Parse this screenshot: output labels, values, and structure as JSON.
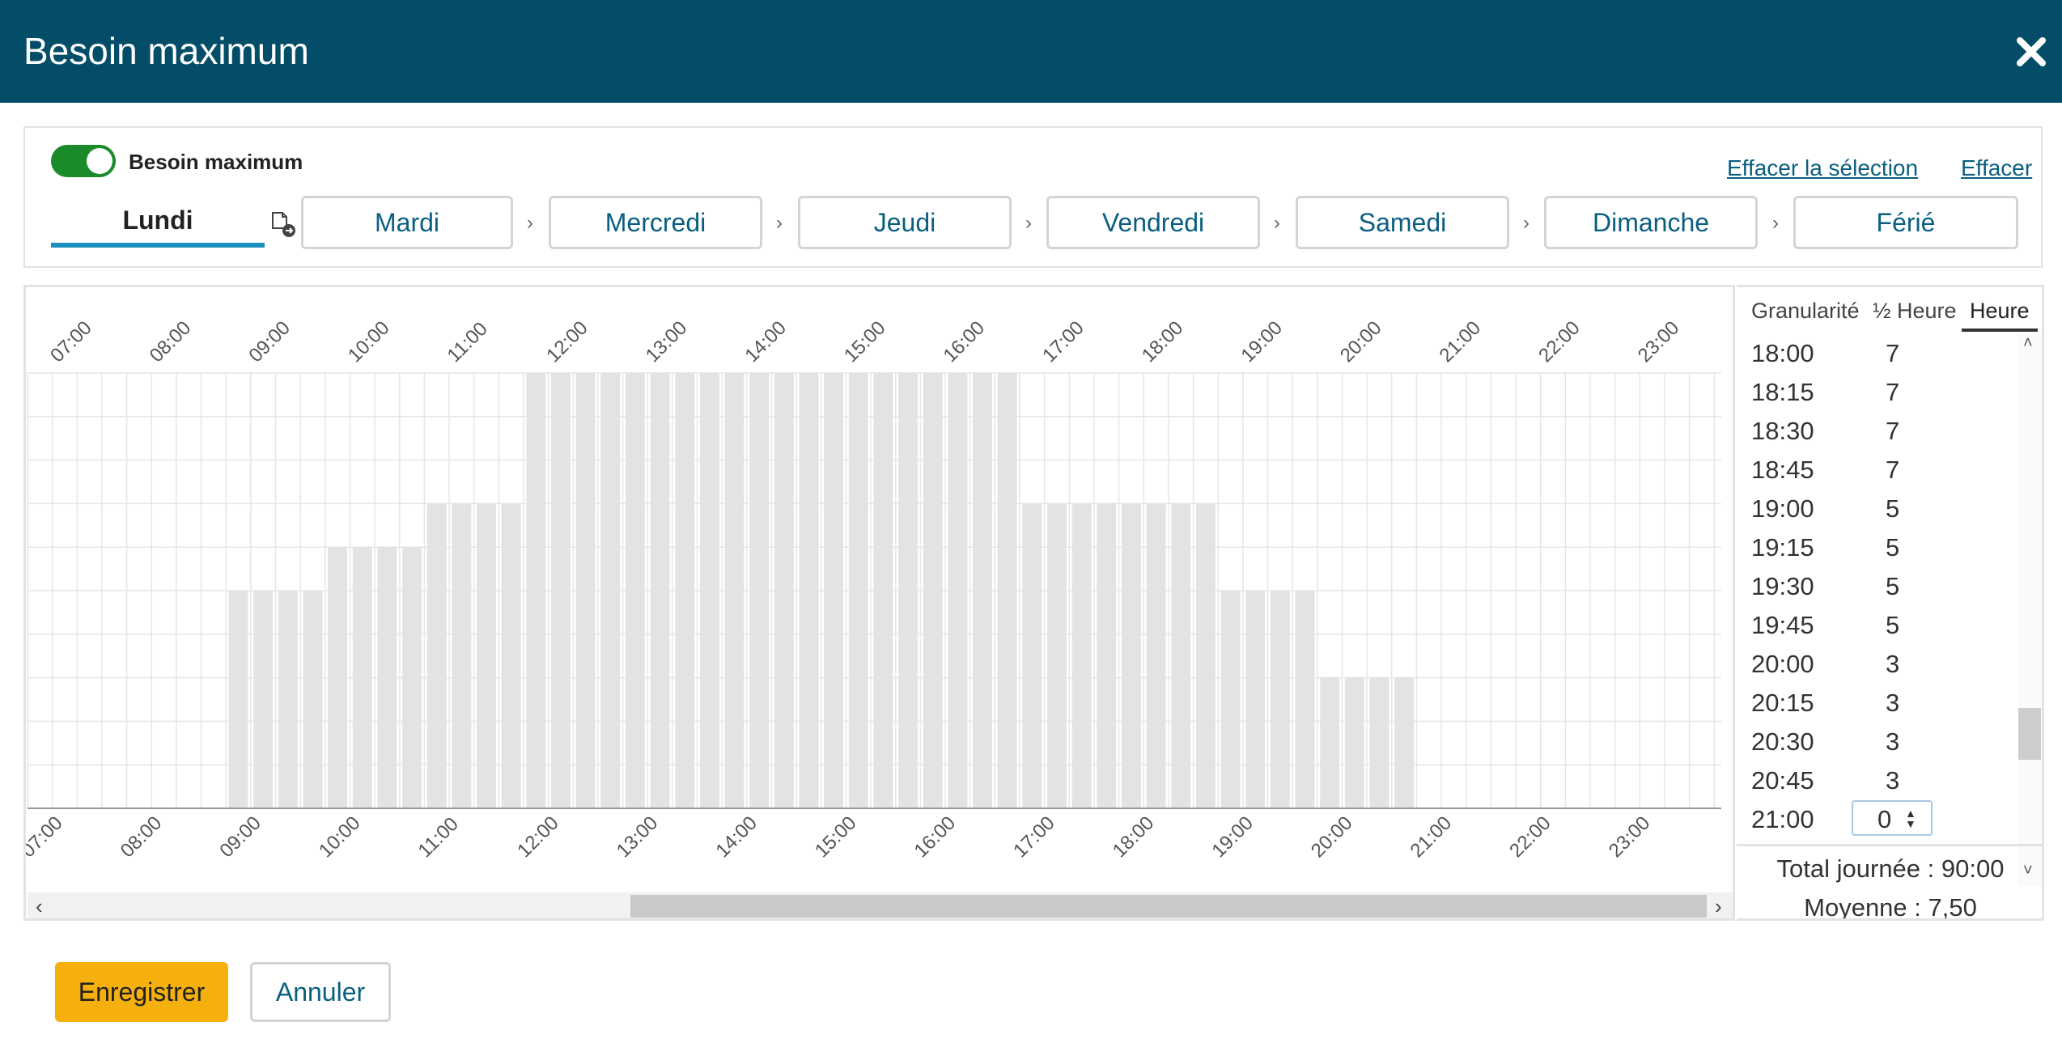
{
  "dialog": {
    "title": "Besoin maximum"
  },
  "toggle": {
    "label": "Besoin maximum",
    "on": true
  },
  "links": {
    "clear_selection": "Effacer la sélection",
    "clear": "Effacer"
  },
  "days": {
    "active": "Lundi",
    "others": [
      "Mardi",
      "Mercredi",
      "Jeudi",
      "Vendredi",
      "Samedi",
      "Dimanche",
      "Férié"
    ],
    "separator": "›"
  },
  "chart_data": {
    "type": "bar",
    "categories": [
      "07:00",
      "07:15",
      "07:30",
      "07:45",
      "08:00",
      "08:15",
      "08:30",
      "08:45",
      "09:00",
      "09:15",
      "09:30",
      "09:45",
      "10:00",
      "10:15",
      "10:30",
      "10:45",
      "11:00",
      "11:15",
      "11:30",
      "11:45",
      "12:00",
      "12:15",
      "12:30",
      "12:45",
      "13:00",
      "13:15",
      "13:30",
      "13:45",
      "14:00",
      "14:15",
      "14:30",
      "14:45",
      "15:00",
      "15:15",
      "15:30",
      "15:45",
      "16:00",
      "16:15",
      "16:30",
      "16:45",
      "17:00",
      "17:15",
      "17:30",
      "17:45",
      "18:00",
      "18:15",
      "18:30",
      "18:45",
      "19:00",
      "19:15",
      "19:30",
      "19:45",
      "20:00",
      "20:15",
      "20:30",
      "20:45",
      "21:00",
      "21:15",
      "21:30",
      "21:45",
      "22:00",
      "22:15",
      "22:30",
      "22:45",
      "23:00",
      "23:15",
      "23:30",
      "23:45"
    ],
    "values": [
      0,
      0,
      0,
      0,
      0,
      0,
      0,
      0,
      5,
      5,
      5,
      5,
      6,
      6,
      6,
      6,
      7,
      7,
      7,
      7,
      10,
      10,
      10,
      10,
      10,
      10,
      10,
      10,
      10,
      10,
      10,
      10,
      10,
      10,
      10,
      10,
      10,
      10,
      10,
      10,
      7,
      7,
      7,
      7,
      7,
      7,
      7,
      7,
      5,
      5,
      5,
      5,
      3,
      3,
      3,
      3,
      0,
      0,
      0,
      0,
      0,
      0,
      0,
      0,
      0,
      0,
      0,
      0
    ],
    "tick_labels": [
      "07:00",
      "08:00",
      "09:00",
      "10:00",
      "11:00",
      "12:00",
      "13:00",
      "14:00",
      "15:00",
      "16:00",
      "17:00",
      "18:00",
      "19:00",
      "20:00",
      "21:00",
      "22:00",
      "23:00"
    ],
    "ylim": [
      0,
      10
    ],
    "grid": true,
    "bar_color": "#e3e3e3"
  },
  "granularity": {
    "label": "Granularité",
    "options": [
      "½ Heure",
      "Heure"
    ],
    "active": "Heure"
  },
  "table": {
    "rows": [
      {
        "time": "18:00",
        "value": "7"
      },
      {
        "time": "18:15",
        "value": "7"
      },
      {
        "time": "18:30",
        "value": "7"
      },
      {
        "time": "18:45",
        "value": "7"
      },
      {
        "time": "19:00",
        "value": "5"
      },
      {
        "time": "19:15",
        "value": "5"
      },
      {
        "time": "19:30",
        "value": "5"
      },
      {
        "time": "19:45",
        "value": "5"
      },
      {
        "time": "20:00",
        "value": "3"
      },
      {
        "time": "20:15",
        "value": "3"
      },
      {
        "time": "20:30",
        "value": "3"
      },
      {
        "time": "20:45",
        "value": "3"
      }
    ],
    "editing": {
      "time": "21:00",
      "value": "0"
    }
  },
  "totals": {
    "total": "Total journée : 90:00",
    "average": "Moyenne : 7,50"
  },
  "buttons": {
    "save": "Enregistrer",
    "cancel": "Annuler"
  },
  "colors": {
    "header": "#034d68",
    "accent": "#1a8fc0",
    "save": "#f5b00e",
    "toggle": "#1b8a2a"
  }
}
